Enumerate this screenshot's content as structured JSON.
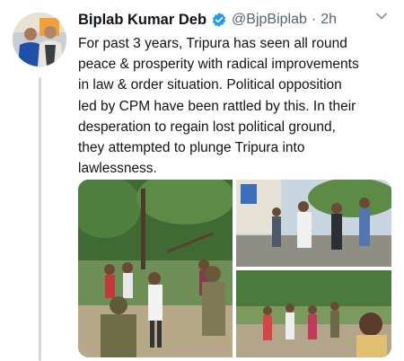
{
  "tweet": {
    "author_name": "Biplab Kumar Deb",
    "handle": "@BjpBiplab",
    "separator": "·",
    "time": "2h",
    "text_lines": [
      "For past 3 years, Tripura has seen all round",
      "peace & prosperity with radical improvements",
      "in law & order situation. Political opposition",
      "led by CPM have been rattled by this. In their",
      "desperation to regain lost political ground,",
      "they attempted to plunge Tripura into",
      "lawlessness."
    ],
    "verified": true,
    "icons": {
      "verified": "verified-badge-icon",
      "more": "chevron-down-icon"
    },
    "colors": {
      "verified_blue": "#1d9bf0",
      "muted_text": "#536471",
      "thread_line": "#cfd9de"
    }
  }
}
